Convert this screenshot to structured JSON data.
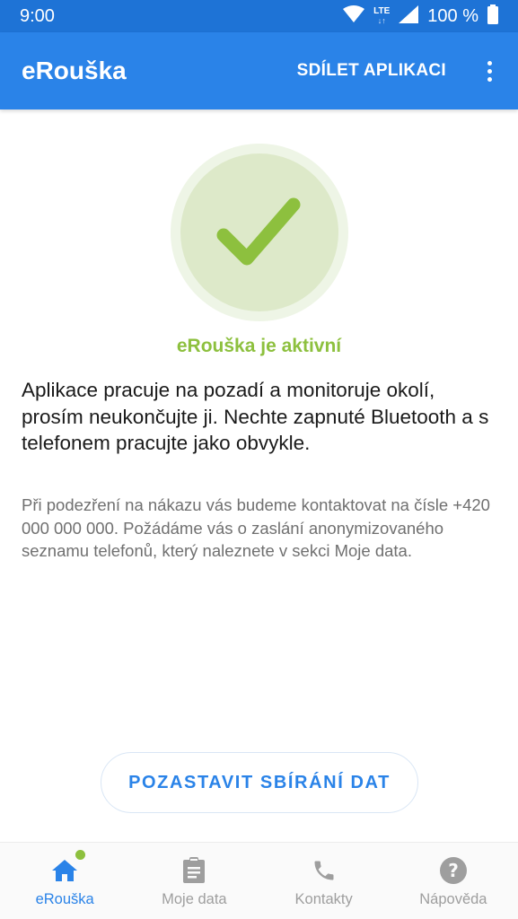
{
  "status_bar": {
    "time": "9:00",
    "network": "LTE",
    "battery": "100 %"
  },
  "app_bar": {
    "title": "eRouška",
    "share_label": "SDÍLET APLIKACI",
    "menu_icon": "more-vert-icon"
  },
  "status": {
    "icon": "check-icon",
    "title": "eRouška je aktivní",
    "colors": {
      "accent_green": "#8dc03e",
      "circle_outer": "#eef5e6",
      "circle_inner": "#dde9c9"
    }
  },
  "main": {
    "description": "Aplikace pracuje na pozadí a monitoruje okolí, prosím neukončujte ji. Nechte zapnuté Bluetooth a s telefonem pracujte jako obvykle.",
    "info": "Při podezření na nákazu vás budeme kontaktovat na čísle +420 000 000 000. Požádáme vás o zaslání anonymizovaného seznamu telefonů, který naleznete v sekci Moje data.",
    "pause_button": "POZASTAVIT SBÍRÁNÍ DAT"
  },
  "bottom_nav": {
    "items": [
      {
        "label": "eRouška",
        "icon": "home-icon",
        "active": true
      },
      {
        "label": "Moje data",
        "icon": "clipboard-icon",
        "active": false
      },
      {
        "label": "Kontakty",
        "icon": "phone-icon",
        "active": false
      },
      {
        "label": "Nápověda",
        "icon": "help-icon",
        "active": false
      }
    ]
  },
  "colors": {
    "primary": "#2a83e8",
    "status_bar": "#1e73d6",
    "inactive_nav": "#9e9e9e"
  }
}
